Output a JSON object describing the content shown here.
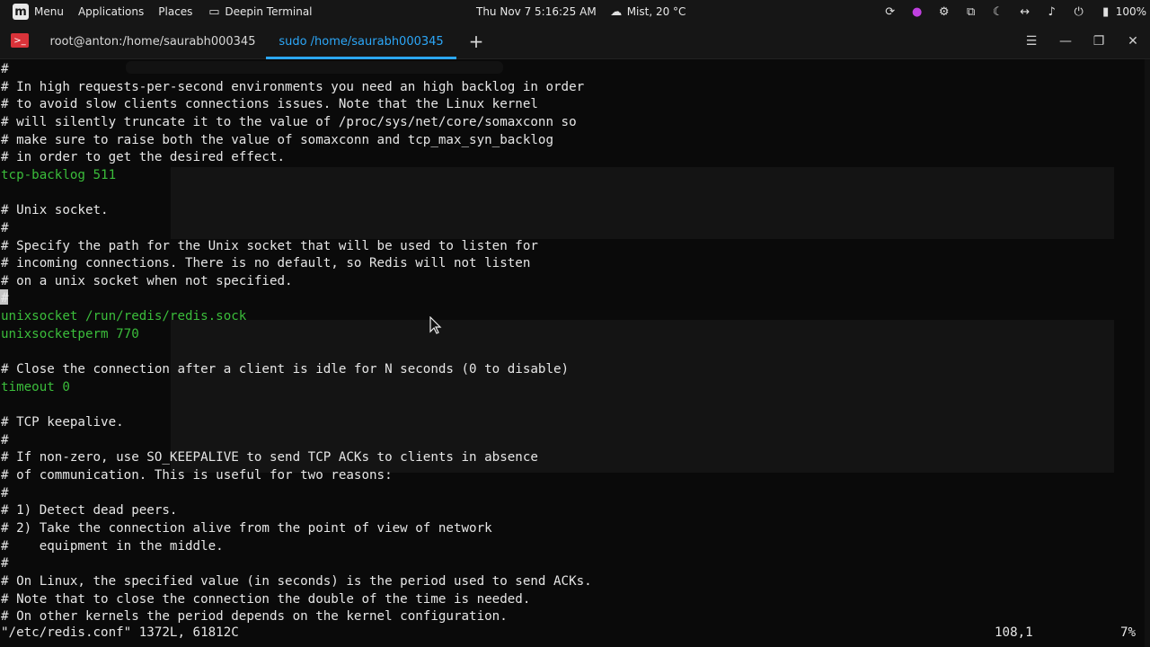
{
  "panel": {
    "menu": "Menu",
    "applications": "Applications",
    "places": "Places",
    "active_app": "Deepin Terminal",
    "datetime": "Thu Nov 7  5:16:25 AM",
    "weather": "Mist, 20 °C",
    "battery": "100%"
  },
  "tabs": [
    {
      "label": "root@anton:/home/saurabh000345"
    },
    {
      "label": "sudo /home/saurabh000345"
    }
  ],
  "terminal": {
    "lines": [
      {
        "text": "#",
        "kind": "comment"
      },
      {
        "text": "# In high requests-per-second environments you need an high backlog in order",
        "kind": "comment"
      },
      {
        "text": "# to avoid slow clients connections issues. Note that the Linux kernel",
        "kind": "comment"
      },
      {
        "text": "# will silently truncate it to the value of /proc/sys/net/core/somaxconn so",
        "kind": "comment"
      },
      {
        "text": "# make sure to raise both the value of somaxconn and tcp_max_syn_backlog",
        "kind": "comment"
      },
      {
        "text": "# in order to get the desired effect.",
        "kind": "comment"
      },
      {
        "text": "tcp-backlog 511",
        "kind": "directive"
      },
      {
        "text": "",
        "kind": "comment"
      },
      {
        "text": "# Unix socket.",
        "kind": "comment"
      },
      {
        "text": "#",
        "kind": "comment"
      },
      {
        "text": "# Specify the path for the Unix socket that will be used to listen for",
        "kind": "comment"
      },
      {
        "text": "# incoming connections. There is no default, so Redis will not listen",
        "kind": "comment"
      },
      {
        "text": "# on a unix socket when not specified.",
        "kind": "comment"
      },
      {
        "text": "#",
        "kind": "comment"
      },
      {
        "text": "unixsocket /run/redis/redis.sock",
        "kind": "directive"
      },
      {
        "text": "unixsocketperm 770",
        "kind": "directive"
      },
      {
        "text": "",
        "kind": "comment"
      },
      {
        "text": "# Close the connection after a client is idle for N seconds (0 to disable)",
        "kind": "comment"
      },
      {
        "text": "timeout 0",
        "kind": "directive"
      },
      {
        "text": "",
        "kind": "comment"
      },
      {
        "text": "# TCP keepalive.",
        "kind": "comment"
      },
      {
        "text": "#",
        "kind": "comment"
      },
      {
        "text": "# If non-zero, use SO_KEEPALIVE to send TCP ACKs to clients in absence",
        "kind": "comment"
      },
      {
        "text": "# of communication. This is useful for two reasons:",
        "kind": "comment"
      },
      {
        "text": "#",
        "kind": "comment"
      },
      {
        "text": "# 1) Detect dead peers.",
        "kind": "comment"
      },
      {
        "text": "# 2) Take the connection alive from the point of view of network",
        "kind": "comment"
      },
      {
        "text": "#    equipment in the middle.",
        "kind": "comment"
      },
      {
        "text": "#",
        "kind": "comment"
      },
      {
        "text": "# On Linux, the specified value (in seconds) is the period used to send ACKs.",
        "kind": "comment"
      },
      {
        "text": "# Note that to close the connection the double of the time is needed.",
        "kind": "comment"
      },
      {
        "text": "# On other kernels the period depends on the kernel configuration.",
        "kind": "comment"
      }
    ],
    "status": {
      "file": "\"/etc/redis.conf\" 1372L, 61812C",
      "position": "108,1",
      "percent": "7%"
    }
  },
  "colors": {
    "directive": "#3bbd3b",
    "comment": "#e6e6e6",
    "active_tab": "#2ca7f8"
  }
}
